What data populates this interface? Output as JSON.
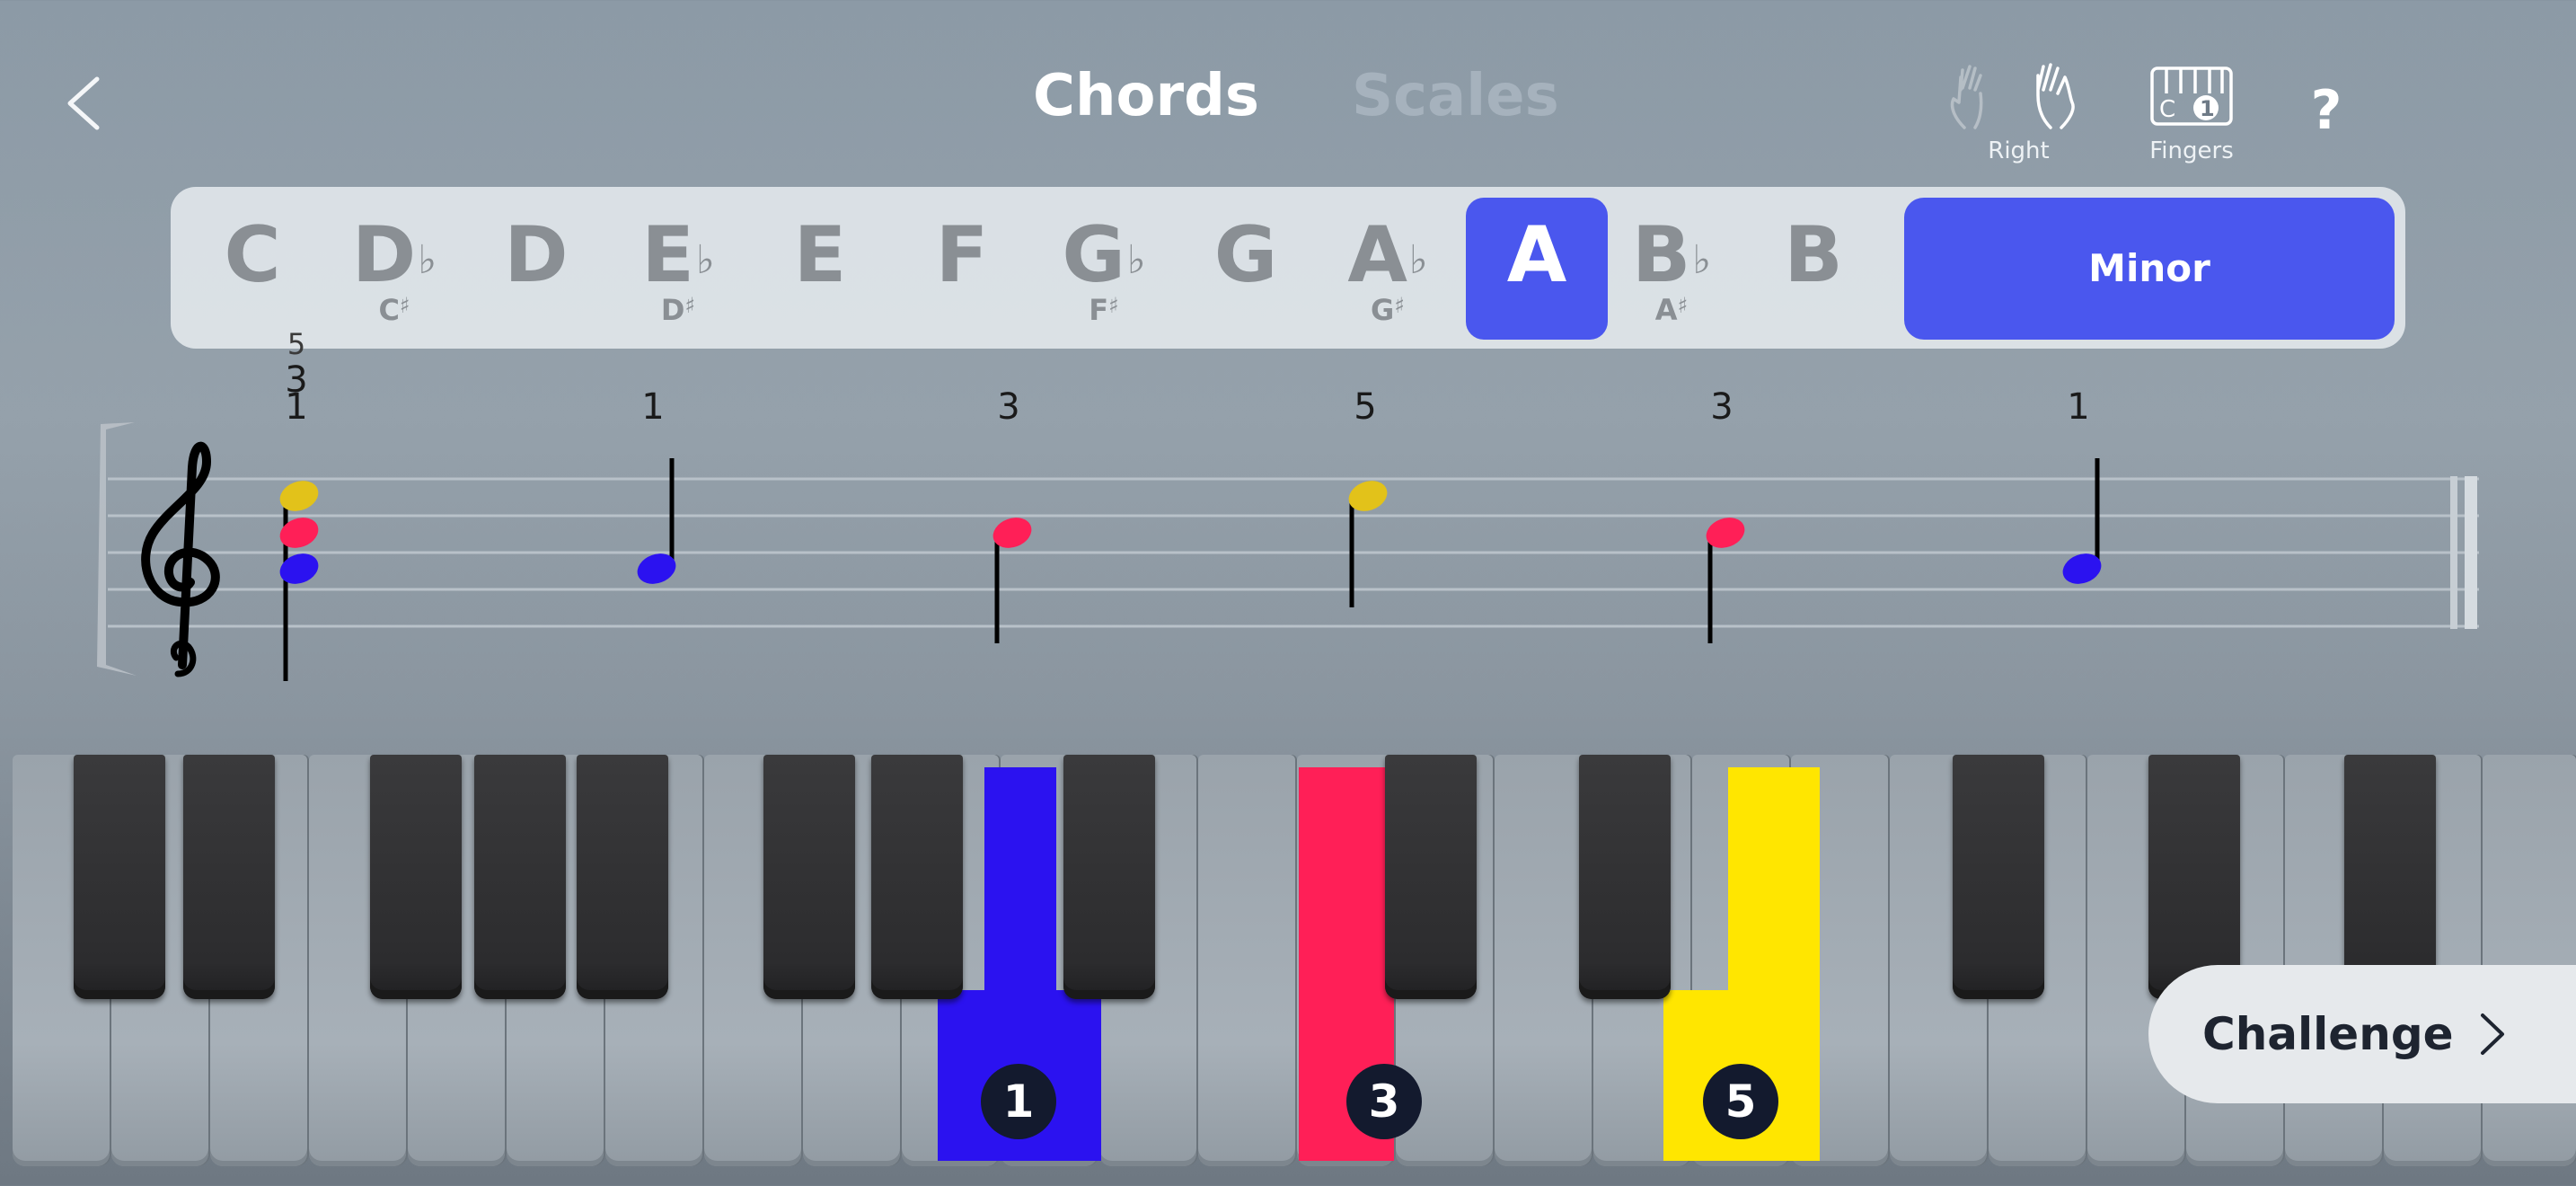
{
  "header": {
    "back_icon": "chevron-left-icon",
    "tabs": [
      {
        "label": "Chords",
        "active": true
      },
      {
        "label": "Scales",
        "active": false
      }
    ],
    "hand_label": "Right",
    "fingers_label": "Fingers",
    "fingers_icon_letter": "C",
    "fingers_icon_number": "1",
    "help_label": "?"
  },
  "key_selector": {
    "keys": [
      {
        "name": "C",
        "acc": "",
        "enh": "",
        "enh_acc": "",
        "active": false
      },
      {
        "name": "D",
        "acc": "♭",
        "enh": "C",
        "enh_acc": "♯",
        "active": false
      },
      {
        "name": "D",
        "acc": "",
        "enh": "",
        "enh_acc": "",
        "active": false
      },
      {
        "name": "E",
        "acc": "♭",
        "enh": "D",
        "enh_acc": "♯",
        "active": false
      },
      {
        "name": "E",
        "acc": "",
        "enh": "",
        "enh_acc": "",
        "active": false
      },
      {
        "name": "F",
        "acc": "",
        "enh": "",
        "enh_acc": "",
        "active": false
      },
      {
        "name": "G",
        "acc": "♭",
        "enh": "F",
        "enh_acc": "♯",
        "active": false
      },
      {
        "name": "G",
        "acc": "",
        "enh": "",
        "enh_acc": "",
        "active": false
      },
      {
        "name": "A",
        "acc": "♭",
        "enh": "G",
        "enh_acc": "♯",
        "active": false
      },
      {
        "name": "A",
        "acc": "",
        "enh": "",
        "enh_acc": "",
        "active": true
      },
      {
        "name": "B",
        "acc": "♭",
        "enh": "A",
        "enh_acc": "♯",
        "active": false
      },
      {
        "name": "B",
        "acc": "",
        "enh": "",
        "enh_acc": "",
        "active": false
      }
    ],
    "quality_label": "Minor"
  },
  "staff": {
    "clef_icon": "treble-clef-icon",
    "chord_fingering": [
      "5",
      "3",
      "1"
    ],
    "note_fingerings": [
      "1",
      "3",
      "5",
      "3",
      "1"
    ]
  },
  "keyboard": {
    "highlighted_fingers": [
      "1",
      "3",
      "5"
    ],
    "colors": {
      "finger_1": "#2b12f0",
      "finger_3": "#ff1f57",
      "finger_5": "#ffe600",
      "accent": "#4a57ee"
    }
  },
  "challenge": {
    "label": "Challenge",
    "icon": "chevron-right-icon"
  }
}
